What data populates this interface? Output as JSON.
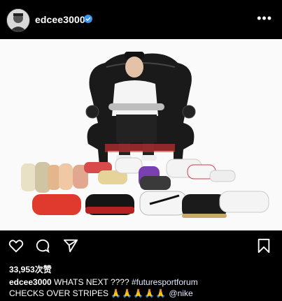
{
  "post": {
    "username": "edcee3000",
    "verified": true,
    "more_icon": "more-horizontal-icon",
    "likes_count": "33,953",
    "likes_suffix": "次赞",
    "caption_user": "edcee3000",
    "caption_text_1": " WHATS NEXT ???? ",
    "caption_hashtag": "#futuresportforum",
    "caption_text_2": "CHECKS OVER STRIPES ",
    "caption_emoji": "🙏🙏🙏🙏🙏",
    "caption_mention": " @nike"
  },
  "actions": {
    "like_icon": "heart-icon",
    "comment_icon": "comment-icon",
    "share_icon": "send-icon",
    "save_icon": "bookmark-icon"
  },
  "colors": {
    "background": "#000000",
    "verified_badge": "#3897f0",
    "photo_bg": "#fafafa"
  }
}
